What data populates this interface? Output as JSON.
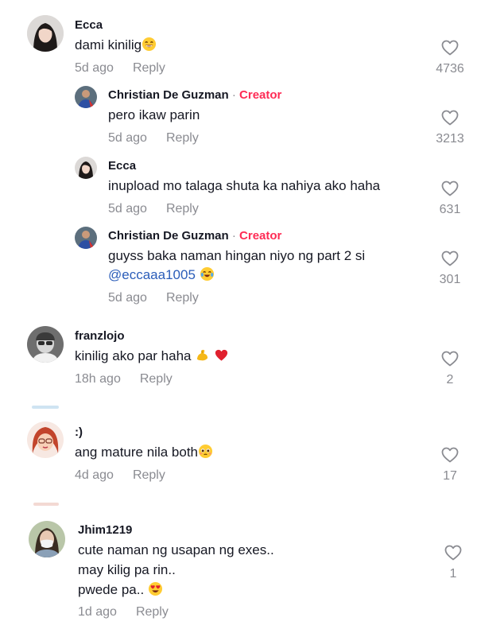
{
  "comments": [
    {
      "user": "Ecca",
      "text": "dami kinilig",
      "time": "5d ago",
      "reply": "Reply",
      "likes": "4736",
      "replies": [
        {
          "user": "Christian De Guzman",
          "separator": "·",
          "badge": "Creator",
          "text": "pero ikaw parin",
          "time": "5d ago",
          "reply": "Reply",
          "likes": "3213"
        },
        {
          "user": "Ecca",
          "text": "inupload mo talaga shuta ka nahiya ako haha",
          "time": "5d ago",
          "reply": "Reply",
          "likes": "631"
        },
        {
          "user": "Christian De Guzman",
          "separator": "·",
          "badge": "Creator",
          "text_line1": "guyss baka naman hingan niyo ng part 2 si",
          "mention": "@eccaaa1005",
          "time": "5d ago",
          "reply": "Reply",
          "likes": "301"
        }
      ]
    },
    {
      "user": "franzlojo",
      "text": "kinilig ako par haha",
      "time": "18h ago",
      "reply": "Reply",
      "likes": "2"
    },
    {
      "user": ":)",
      "text": "ang mature nila both",
      "time": "4d ago",
      "reply": "Reply",
      "likes": "17"
    },
    {
      "user": "Jhim1219",
      "lines": [
        "cute naman ng usapan ng exes..",
        "may kilig pa rin..",
        "pwede pa.."
      ],
      "time": "1d ago",
      "reply": "Reply",
      "likes": "1"
    }
  ],
  "icons": {
    "like": "heart-outline-icon"
  },
  "colors": {
    "creator_badge": "#fe2c55",
    "mention": "#2b5db9",
    "meta": "#8a8b91"
  }
}
